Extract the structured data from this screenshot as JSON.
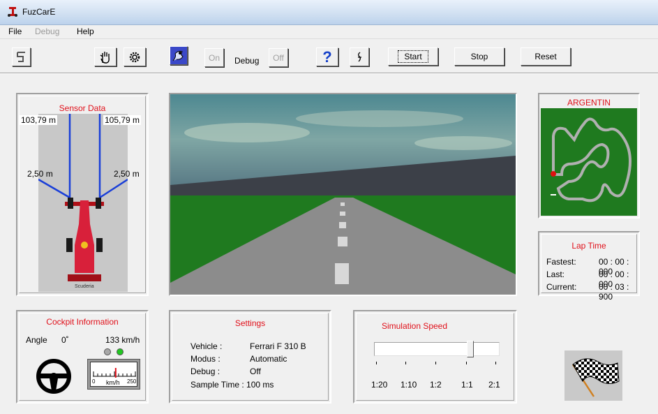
{
  "window": {
    "title": "FuzCarE"
  },
  "menu": {
    "file": "File",
    "debug": "Debug",
    "help": "Help"
  },
  "toolbar": {
    "on_label": "On",
    "debug_label": "Debug",
    "off_label": "Off",
    "start_label": "Start",
    "stop_label": "Stop",
    "reset_label": "Reset",
    "help_glyph": "?"
  },
  "sensor": {
    "title": "Sensor Data",
    "front_left": "103,79 m",
    "front_right": "105,79 m",
    "side_left": "2,50 m",
    "side_right": "2,50 m",
    "car_caption": "Scuderia"
  },
  "track": {
    "name": "ARGENTIN"
  },
  "lap_time": {
    "title": "Lap Time",
    "rows": [
      {
        "label": "Fastest:",
        "value": "00 : 00 : 000"
      },
      {
        "label": "Last:",
        "value": "00 : 00 : 000"
      },
      {
        "label": "Current:",
        "value": "00 : 03 : 900"
      }
    ]
  },
  "cockpit": {
    "title": "Cockpit Information",
    "angle_label": "Angle",
    "angle_value": "0˚",
    "speed": "133 km/h",
    "gauge_min": "0",
    "gauge_max": "250",
    "gauge_unit": "km/h",
    "gauge_fraction": 0.53
  },
  "settings": {
    "title": "Settings",
    "rows": [
      {
        "label": "Vehicle :",
        "value": "Ferrari F 310 B"
      },
      {
        "label": "Modus :",
        "value": "Automatic"
      },
      {
        "label": "Debug :",
        "value": "Off"
      }
    ],
    "sample_time": "Sample Time : 100  ms"
  },
  "simulation": {
    "title": "Simulation Speed",
    "ticks": [
      "1:20",
      "1:10",
      "1:2",
      "1:1",
      "2:1"
    ],
    "selected": "1:1"
  },
  "colors": {
    "accent_red": "#e0101a",
    "grass": "#1f7a1f",
    "road": "#8c8c8c",
    "sky": "#4e8a90",
    "lamp_green": "#22c722",
    "lamp_grey": "#a8a8a8"
  }
}
